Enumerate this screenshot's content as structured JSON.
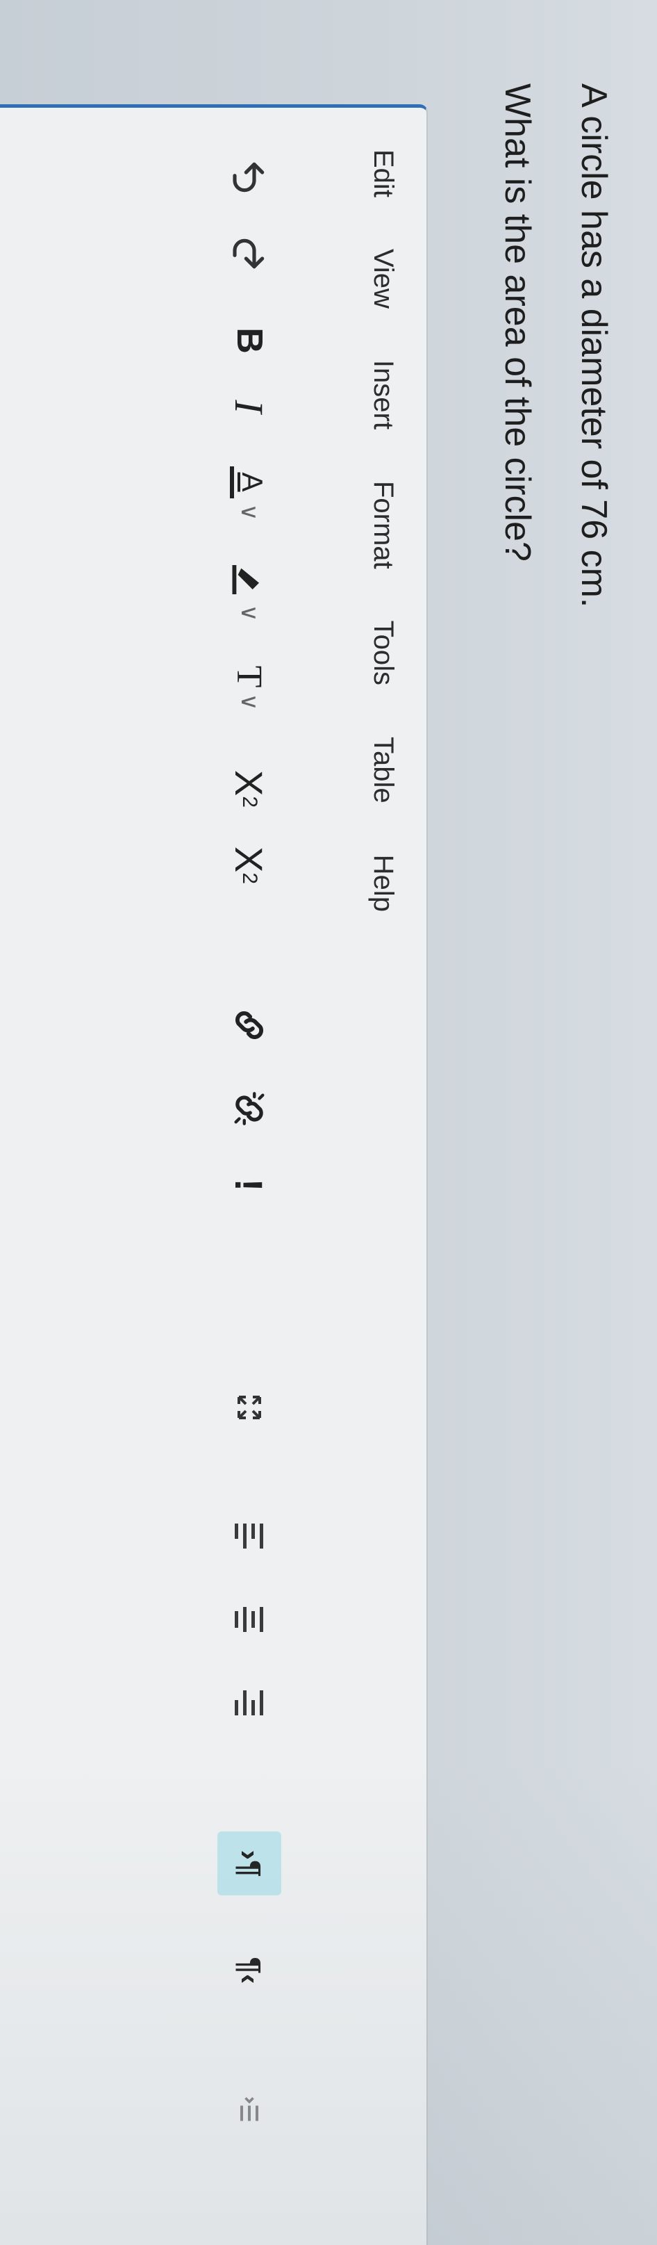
{
  "question": {
    "line1": "A circle has a diameter of 76 cm.",
    "line2": "What is the area of the circle?"
  },
  "menu": [
    "Edit",
    "View",
    "Insert",
    "Format",
    "Tools",
    "Table",
    "Help"
  ],
  "toolbar": {
    "undo_icon": "undo-icon",
    "redo_icon": "redo-icon",
    "bold_label": "B",
    "italic_label": "I",
    "font_color_label": "A",
    "font_color_icon": "font-color-icon",
    "highlight_icon": "highlight-pen-icon",
    "text_format_label": "T",
    "superscript_label": "X",
    "superscript_mark": "2",
    "subscript_label": "X",
    "subscript_mark": "2",
    "link_icon": "link-icon",
    "unlink_icon": "unlink-icon",
    "alert_label": "!",
    "fullscreen_icon": "expand-arrows-icon",
    "align_left_icon": "align-left-icon",
    "align_center_icon": "align-center-icon",
    "align_right_icon": "align-right-icon",
    "ltr_icon": "ltr-paragraph-icon",
    "rtl_icon": "rtl-paragraph-icon",
    "more_icon": "list-icon",
    "chevron": "∨",
    "accent": "#2f6fb8",
    "active_bg": "#bfe4ec"
  }
}
